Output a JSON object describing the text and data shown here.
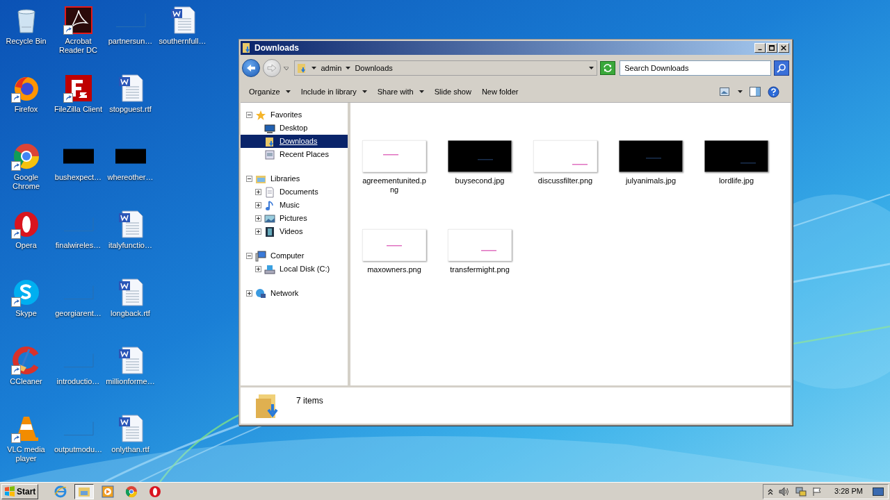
{
  "desktop_icons": [
    {
      "label": "Recycle Bin",
      "kind": "recycle",
      "shortcut": false
    },
    {
      "label": "Firefox",
      "kind": "firefox",
      "shortcut": true
    },
    {
      "label": "Google Chrome",
      "kind": "chrome",
      "shortcut": true
    },
    {
      "label": "Opera",
      "kind": "opera",
      "shortcut": true
    },
    {
      "label": "Skype",
      "kind": "skype",
      "shortcut": true
    },
    {
      "label": "CCleaner",
      "kind": "ccleaner",
      "shortcut": true
    },
    {
      "label": "VLC media player",
      "kind": "vlc",
      "shortcut": true
    },
    {
      "label": "Acrobat Reader DC",
      "kind": "acrobat",
      "shortcut": true
    },
    {
      "label": "FileZilla Client",
      "kind": "filezilla",
      "shortcut": true
    },
    {
      "label": "bushexpect…",
      "kind": "dark",
      "shortcut": false
    },
    {
      "label": "finalwireles…",
      "kind": "blank",
      "shortcut": false
    },
    {
      "label": "georgiarent…",
      "kind": "blank",
      "shortcut": false
    },
    {
      "label": "introductio…",
      "kind": "blank",
      "shortcut": false
    },
    {
      "label": "outputmodu…",
      "kind": "blank",
      "shortcut": false
    },
    {
      "label": "partnersun…",
      "kind": "blank",
      "shortcut": false
    },
    {
      "label": "stopguest.rtf",
      "kind": "word",
      "shortcut": false
    },
    {
      "label": "whereother…",
      "kind": "dark",
      "shortcut": false
    },
    {
      "label": "italyfunctio…",
      "kind": "word",
      "shortcut": false
    },
    {
      "label": "longback.rtf",
      "kind": "word",
      "shortcut": false
    },
    {
      "label": "millionforme…",
      "kind": "word",
      "shortcut": false
    },
    {
      "label": "onlythan.rtf",
      "kind": "word",
      "shortcut": false
    },
    {
      "label": "southernfull…",
      "kind": "word",
      "shortcut": false
    }
  ],
  "window": {
    "title": "Downloads",
    "address": {
      "crumbs": [
        "admin",
        "Downloads"
      ]
    },
    "search": {
      "placeholder": "Search Downloads"
    },
    "toolbar": [
      {
        "label": "Organize",
        "dropdown": true
      },
      {
        "label": "Include in library",
        "dropdown": true
      },
      {
        "label": "Share with",
        "dropdown": true
      },
      {
        "label": "Slide show",
        "dropdown": false
      },
      {
        "label": "New folder",
        "dropdown": false
      }
    ],
    "nav_tree": [
      {
        "label": "Favorites",
        "kind": "star",
        "expanded": true,
        "selected": false,
        "children": [
          {
            "label": "Desktop",
            "kind": "desktop",
            "selected": false
          },
          {
            "label": "Downloads",
            "kind": "downloads",
            "selected": true
          },
          {
            "label": "Recent Places",
            "kind": "recent",
            "selected": false
          }
        ]
      },
      {
        "label": "Libraries",
        "kind": "library",
        "expanded": true,
        "selected": false,
        "children": [
          {
            "label": "Documents",
            "kind": "documents",
            "expanded": false,
            "selected": false
          },
          {
            "label": "Music",
            "kind": "music",
            "expanded": false,
            "selected": false
          },
          {
            "label": "Pictures",
            "kind": "pictures",
            "expanded": false,
            "selected": false
          },
          {
            "label": "Videos",
            "kind": "videos",
            "expanded": false,
            "selected": false
          }
        ]
      },
      {
        "label": "Computer",
        "kind": "computer",
        "expanded": true,
        "selected": false,
        "children": [
          {
            "label": "Local Disk (C:)",
            "kind": "disk",
            "expanded": false,
            "selected": false
          }
        ]
      },
      {
        "label": "Network",
        "kind": "network",
        "expanded": false,
        "selected": false
      }
    ],
    "files": [
      {
        "name": "agreementunited.png",
        "kind": "light"
      },
      {
        "name": "buysecond.jpg",
        "kind": "dark"
      },
      {
        "name": "discussfilter.png",
        "kind": "light"
      },
      {
        "name": "julyanimals.jpg",
        "kind": "dark"
      },
      {
        "name": "lordlife.jpg",
        "kind": "dark"
      },
      {
        "name": "maxowners.png",
        "kind": "light"
      },
      {
        "name": "transfermight.png",
        "kind": "light"
      }
    ],
    "status": "7 items"
  },
  "taskbar": {
    "start": "Start",
    "apps": [
      {
        "kind": "ie",
        "selected": false
      },
      {
        "kind": "explorer",
        "selected": true
      },
      {
        "kind": "media",
        "selected": false
      },
      {
        "kind": "chrome",
        "selected": false
      },
      {
        "kind": "opera",
        "selected": false
      }
    ],
    "clock": "3:28 PM"
  }
}
